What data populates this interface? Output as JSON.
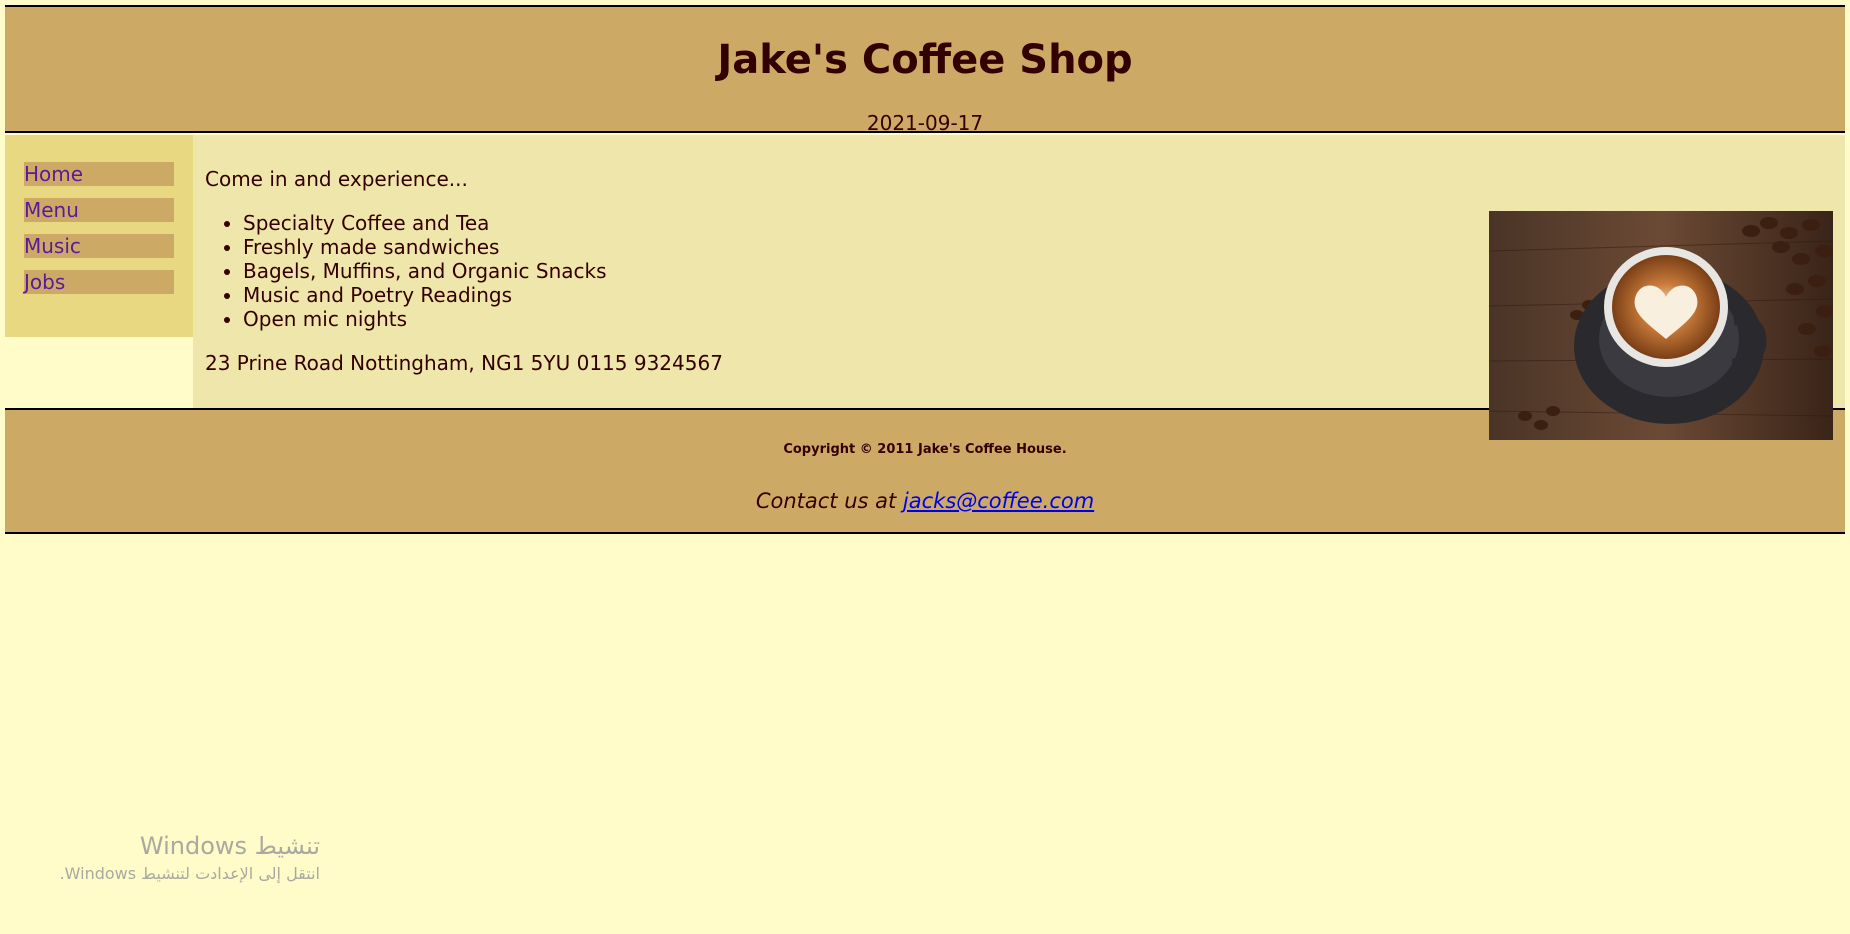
{
  "header": {
    "title": "Jake's Coffee Shop",
    "date": "2021-09-17"
  },
  "nav": {
    "items": [
      {
        "label": "Home"
      },
      {
        "label": "Menu"
      },
      {
        "label": "Music"
      },
      {
        "label": "Jobs"
      }
    ]
  },
  "content": {
    "intro": "Come in and experience...",
    "features": [
      "Specialty Coffee and Tea",
      "Freshly made sandwiches",
      "Bagels, Muffins, and Organic Snacks",
      "Music and Poetry Readings",
      "Open mic nights"
    ],
    "address": "23 Prine Road Nottingham, NG1 5YU 0115 9324567"
  },
  "footer": {
    "copyright": "Copyright © 2011 Jake's Coffee House.",
    "contact_prefix": "Contact us at ",
    "email": "jacks@coffee.com"
  },
  "watermark": {
    "line1": "تنشيط Windows",
    "line2": "انتقل إلى الإعدادت لتنشيط Windows."
  },
  "colors": {
    "header_bg": "#ccaa66",
    "nav_bg": "#e8d882",
    "content_bg": "#efe6ab",
    "page_bg": "#fffcc9",
    "text": "#330000",
    "nav_link": "#5a1a99"
  }
}
